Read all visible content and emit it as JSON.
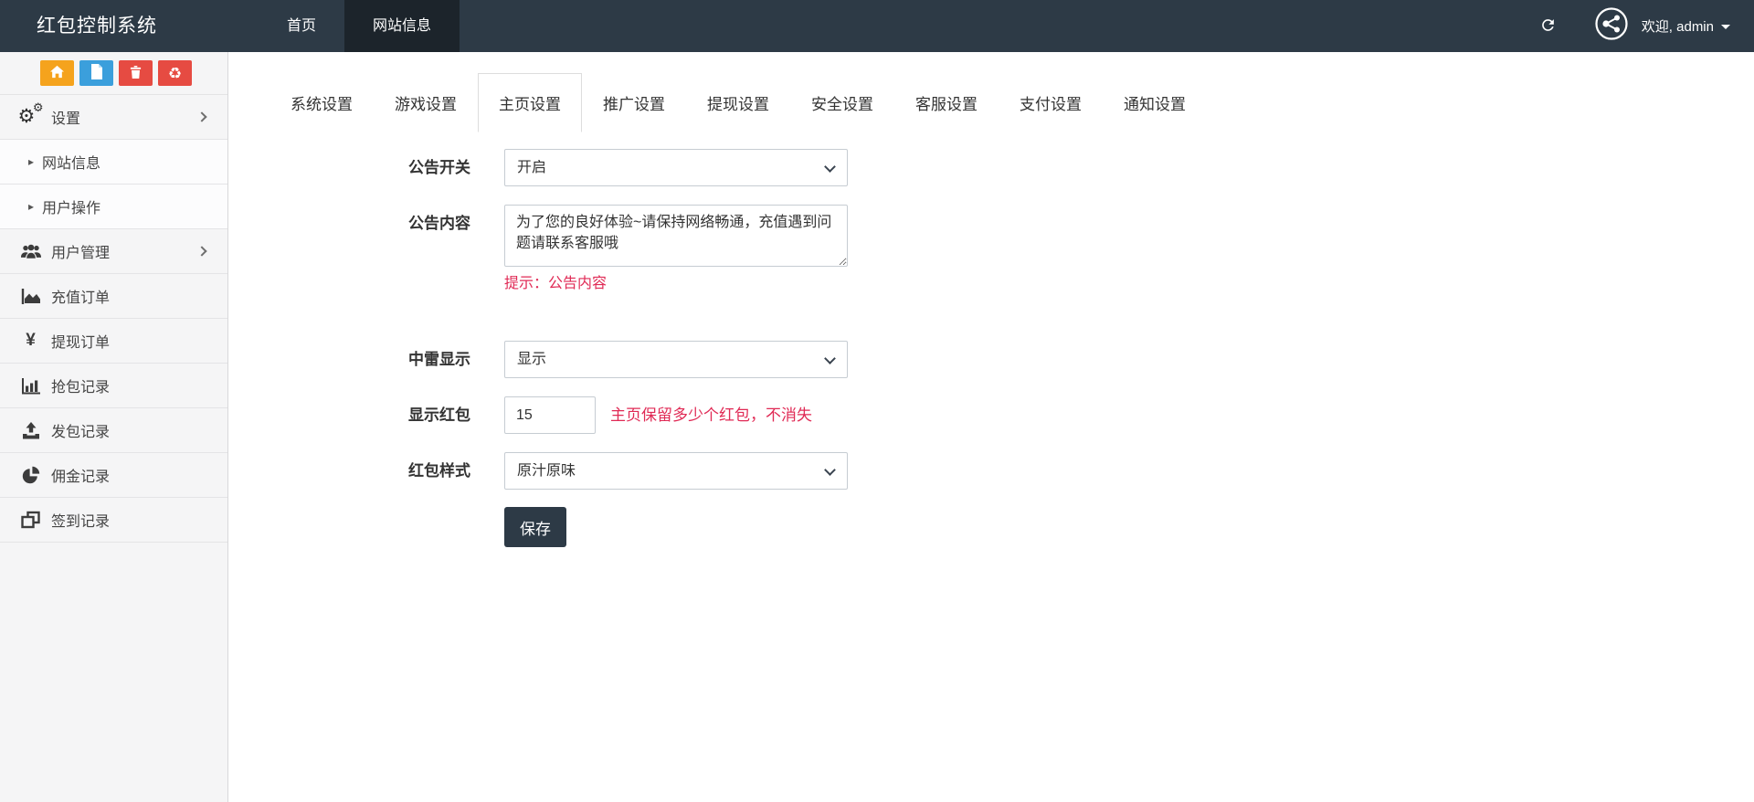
{
  "navbar": {
    "brand": "红包控制系统",
    "items": [
      {
        "label": "首页",
        "active": false
      },
      {
        "label": "网站信息",
        "active": true
      }
    ],
    "welcome": "欢迎, admin"
  },
  "sidebar": {
    "quick_buttons": [
      {
        "name": "home",
        "color": "#f5a31d"
      },
      {
        "name": "file",
        "color": "#3b9fdc"
      },
      {
        "name": "trash",
        "color": "#e64b42"
      },
      {
        "name": "recycle",
        "color": "#e64b42"
      }
    ],
    "menu": [
      {
        "label": "设置",
        "icon": "gears",
        "type": "parent"
      },
      {
        "label": "网站信息",
        "icon": "caret-right",
        "type": "sub"
      },
      {
        "label": "用户操作",
        "icon": "caret-right",
        "type": "sub"
      },
      {
        "label": "用户管理",
        "icon": "users",
        "type": "parent"
      },
      {
        "label": "充值订单",
        "icon": "area-chart",
        "type": "leaf"
      },
      {
        "label": "提现订单",
        "icon": "yen",
        "type": "leaf"
      },
      {
        "label": "抢包记录",
        "icon": "bar-chart",
        "type": "leaf"
      },
      {
        "label": "发包记录",
        "icon": "upload",
        "type": "leaf"
      },
      {
        "label": "佣金记录",
        "icon": "pie-chart",
        "type": "leaf"
      },
      {
        "label": "签到记录",
        "icon": "clone",
        "type": "leaf"
      }
    ]
  },
  "tabs": [
    "系统设置",
    "游戏设置",
    "主页设置",
    "推广设置",
    "提现设置",
    "安全设置",
    "客服设置",
    "支付设置",
    "通知设置"
  ],
  "active_tab": "主页设置",
  "form": {
    "announce_switch": {
      "label": "公告开关",
      "value": "开启"
    },
    "announce_content": {
      "label": "公告内容",
      "value": "为了您的良好体验~请保持网络畅通，充值遇到问题请联系客服哦",
      "hint": "提示：公告内容"
    },
    "mine_display": {
      "label": "中雷显示",
      "value": "显示"
    },
    "show_packets": {
      "label": "显示红包",
      "value": "15",
      "hint": "主页保留多少个红包，不消失"
    },
    "packet_style": {
      "label": "红包样式",
      "value": "原汁原味"
    },
    "save_label": "保存"
  },
  "colors": {
    "navbar_bg": "#2d3a46",
    "navbar_active_bg": "#1c242b",
    "sidebar_bg": "#f5f5f6",
    "hint_red": "#e02a55",
    "btn_home": "#f5a31d",
    "btn_file": "#3b9fdc",
    "btn_danger": "#e64b42",
    "save_btn_bg": "#2d3a46"
  }
}
